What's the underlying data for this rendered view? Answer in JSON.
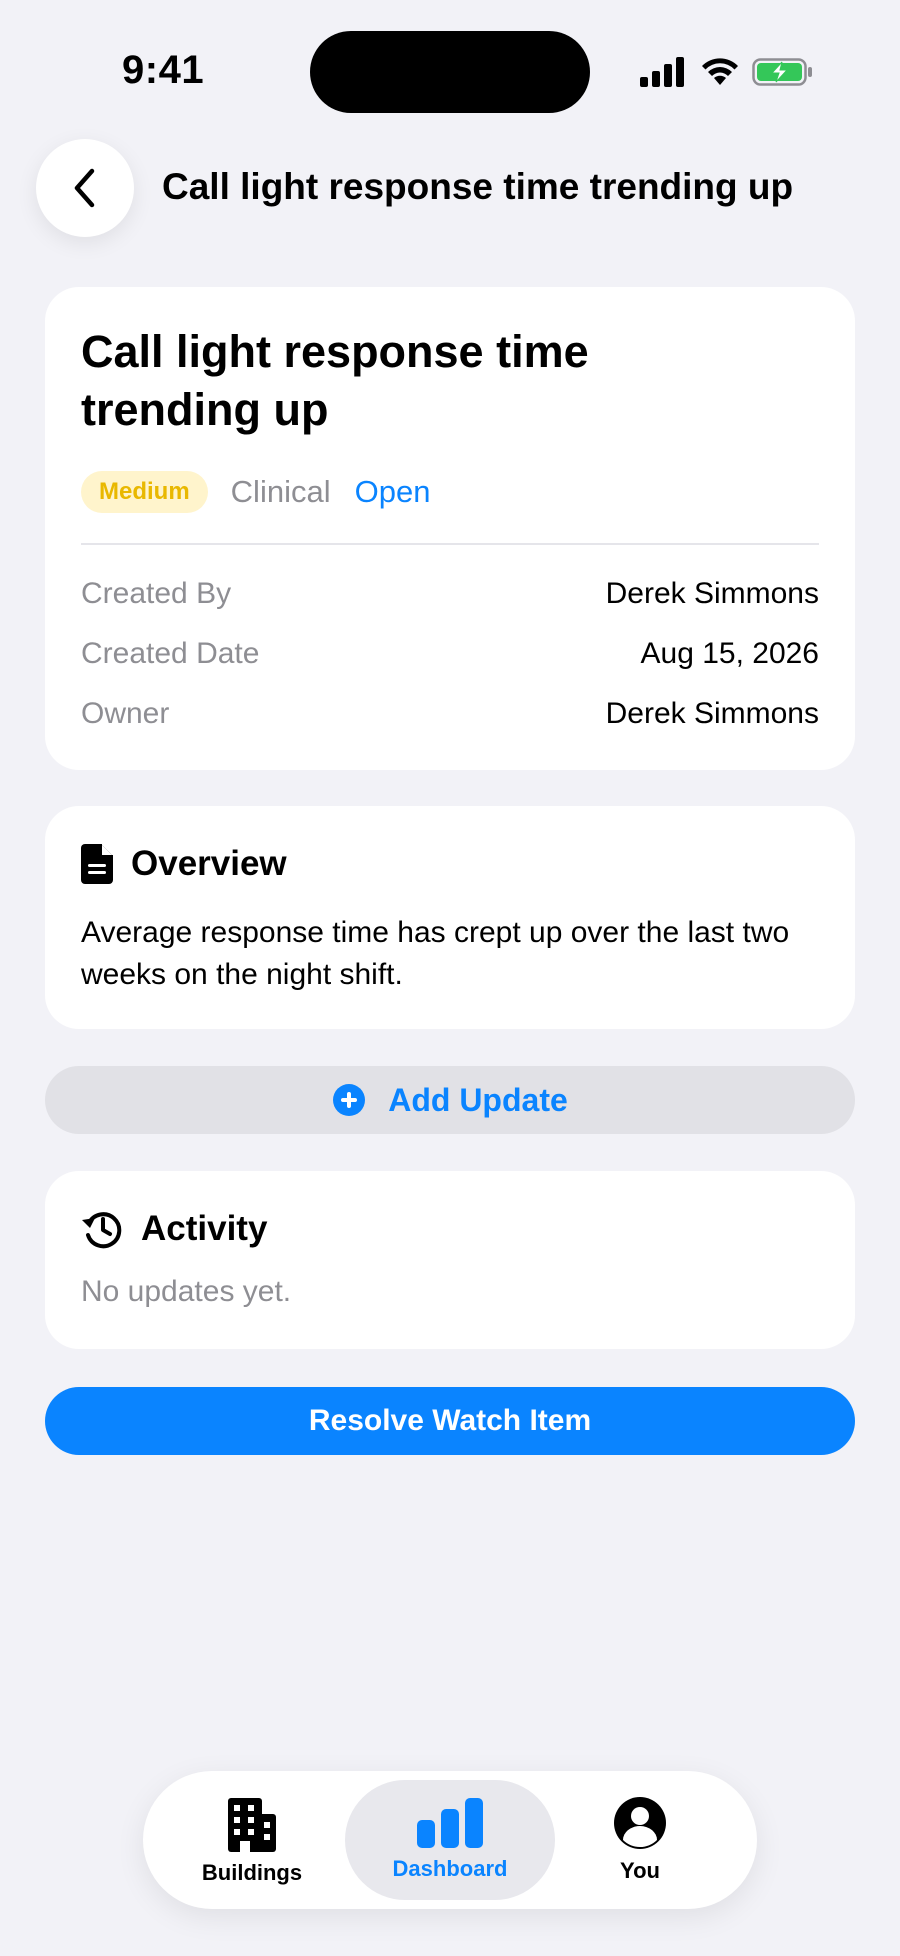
{
  "status_bar": {
    "time": "9:41"
  },
  "nav": {
    "title": "Call light response time trending up",
    "back_icon": "chevron-left-icon"
  },
  "item": {
    "title": "Call light response time trending up",
    "severity": "Medium",
    "category": "Clinical",
    "status": "Open",
    "meta": [
      {
        "key": "Created By",
        "value": "Derek Simmons"
      },
      {
        "key": "Created Date",
        "value": "Aug 15, 2026"
      },
      {
        "key": "Owner",
        "value": "Derek Simmons"
      }
    ]
  },
  "overview": {
    "icon": "document-icon",
    "title": "Overview",
    "text": "Average response time has crept up over the last two weeks on the night shift."
  },
  "add_update": {
    "icon": "plus-circle-icon",
    "label": "Add Update"
  },
  "activity": {
    "icon": "history-icon",
    "title": "Activity",
    "empty_text": "No updates yet."
  },
  "resolve": {
    "label": "Resolve Watch Item"
  },
  "tab_bar": {
    "tabs": [
      {
        "label": "Buildings",
        "icon": "buildings-icon",
        "active": false
      },
      {
        "label": "Dashboard",
        "icon": "bar-chart-icon",
        "active": true
      },
      {
        "label": "You",
        "icon": "person-icon",
        "active": false
      }
    ]
  },
  "colors": {
    "accent": "#0A84FF",
    "background": "#F2F2F7",
    "severity_text": "#E9B800",
    "severity_bg": "#FFF4CC",
    "battery": "#34C759"
  }
}
